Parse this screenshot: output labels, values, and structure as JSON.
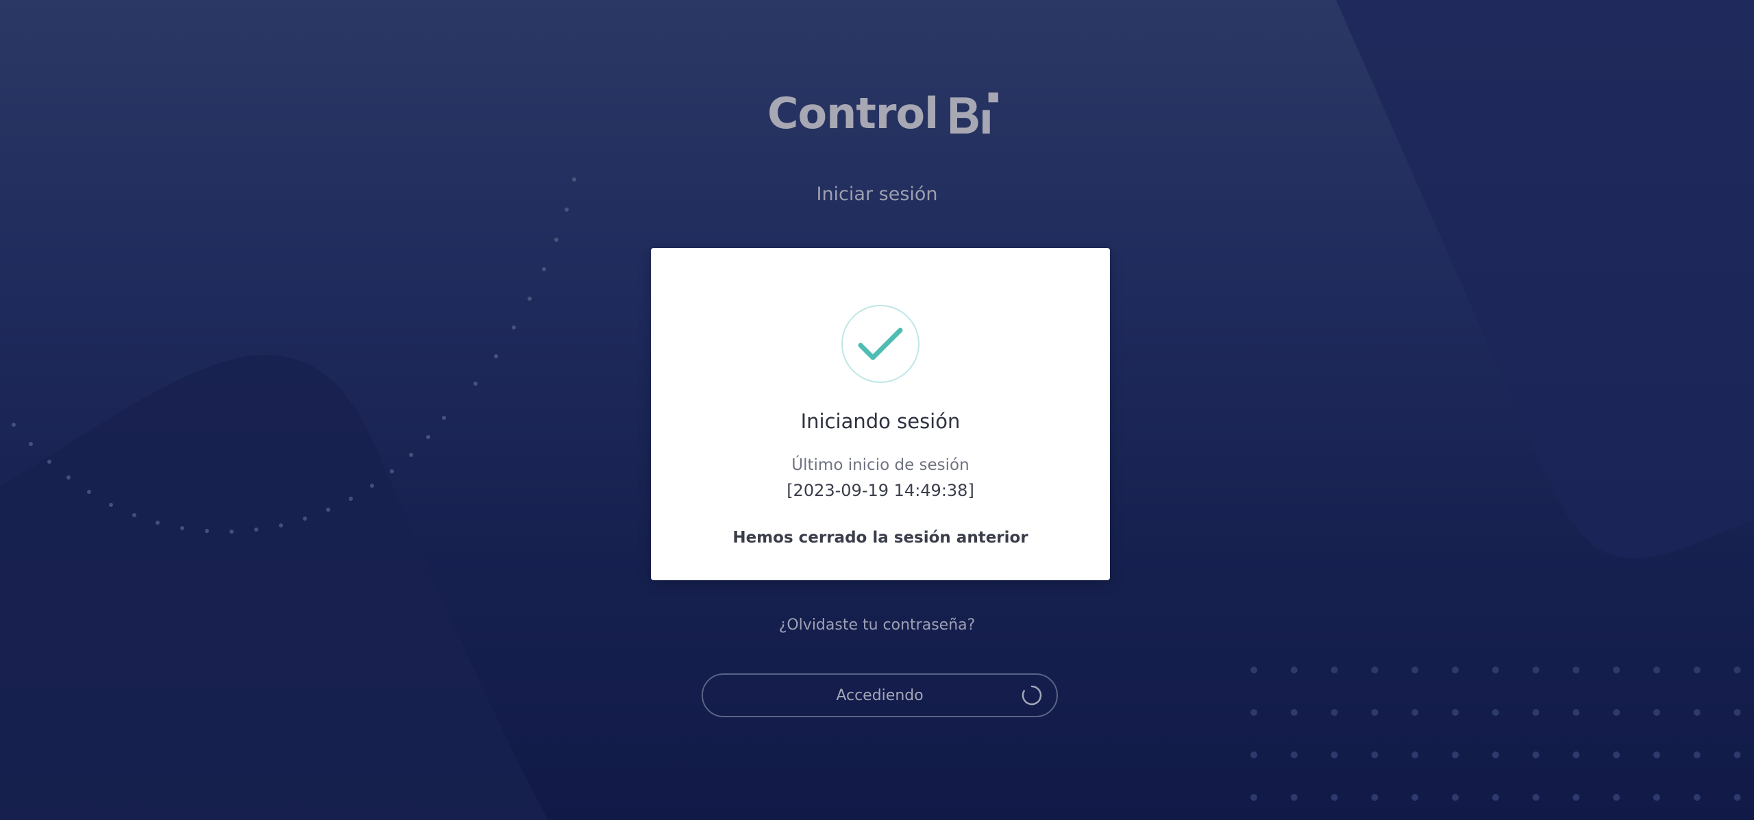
{
  "logo": {
    "text": "Control",
    "mark_text": "Bi"
  },
  "subtitle": "Iniciar sesión",
  "card": {
    "title": "Iniciando sesión",
    "last_login_label": "Último inicio de sesión",
    "last_login_value": "[2023-09-19 14:49:38]",
    "message": "Hemos cerrado la sesión anterior",
    "status_icon": "check-circle-icon"
  },
  "forgot_password_label": "¿Olvidaste tu contraseña?",
  "access_button": {
    "label": "Accediendo",
    "icon": "loading-spinner-icon"
  },
  "colors": {
    "background_top": "#2b3764",
    "background_bottom": "#111a47",
    "check_color": "#4fbdb4",
    "card_bg": "#ffffff"
  }
}
